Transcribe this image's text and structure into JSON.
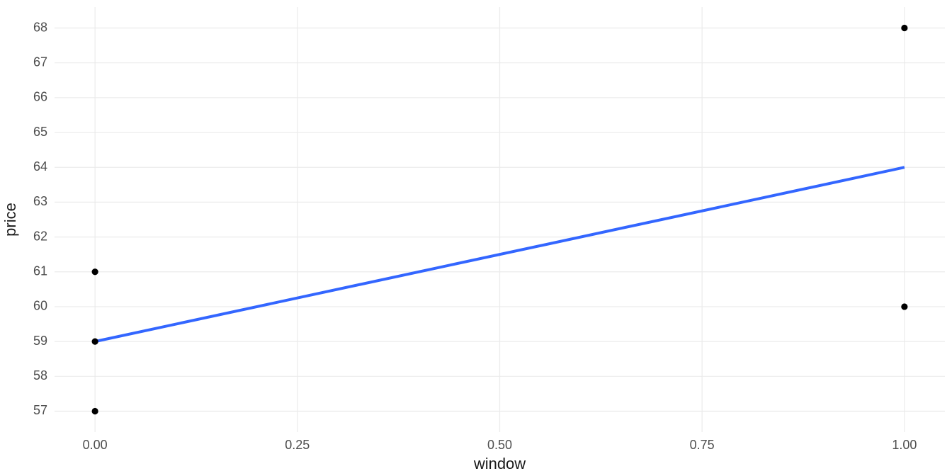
{
  "chart_data": {
    "type": "scatter",
    "xlabel": "window",
    "ylabel": "price",
    "title": "",
    "xlim": [
      -0.05,
      1.05
    ],
    "ylim": [
      56.4,
      68.6
    ],
    "x_ticks": [
      0.0,
      0.25,
      0.5,
      0.75,
      1.0
    ],
    "x_tick_labels": [
      "0.00",
      "0.25",
      "0.50",
      "0.75",
      "1.00"
    ],
    "y_ticks": [
      57,
      58,
      59,
      60,
      61,
      62,
      63,
      64,
      65,
      66,
      67,
      68
    ],
    "y_tick_labels": [
      "57",
      "58",
      "59",
      "60",
      "61",
      "62",
      "63",
      "64",
      "65",
      "66",
      "67",
      "68"
    ],
    "series": [
      {
        "name": "points",
        "kind": "scatter",
        "x": [
          0,
          0,
          0,
          1,
          1
        ],
        "y": [
          57,
          59,
          61,
          60,
          68
        ]
      },
      {
        "name": "lm-fit",
        "kind": "line",
        "x": [
          0,
          1
        ],
        "y": [
          59,
          64
        ]
      }
    ],
    "color_line": "#3366ff"
  }
}
